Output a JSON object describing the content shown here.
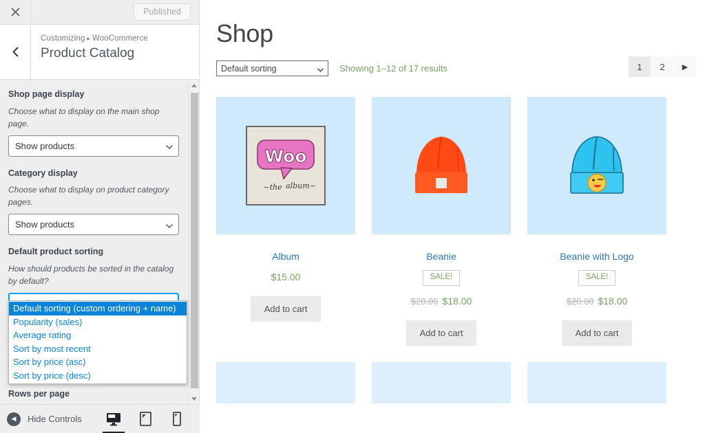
{
  "customizer": {
    "close_icon": "close-icon",
    "published_label": "Published",
    "back_icon": "chevron-left-icon",
    "breadcrumb_root": "Customizing",
    "breadcrumb_sep": "▸",
    "breadcrumb_section": "WooCommerce",
    "panel_title": "Product Catalog",
    "controls": [
      {
        "label": "Shop page display",
        "description": "Choose what to display on the main shop page.",
        "value": "Show products"
      },
      {
        "label": "Category display",
        "description": "Choose what to display on product category pages.",
        "value": "Show products"
      },
      {
        "label": "Default product sorting",
        "description": "How should products be sorted in the catalog by default?",
        "value": "Default sorting (custom ordering + r"
      }
    ],
    "sorting_options": [
      "Default sorting (custom ordering + name)",
      "Popularity (sales)",
      "Average rating",
      "Sort by most recent",
      "Sort by price (asc)",
      "Sort by price (desc)"
    ],
    "sorting_selected_index": 0,
    "rows_per_page_label": "Rows per page",
    "footer": {
      "hide_controls_label": "Hide Controls",
      "devices": [
        {
          "name": "desktop",
          "active": true
        },
        {
          "name": "tablet",
          "active": false
        },
        {
          "name": "mobile",
          "active": false
        }
      ]
    }
  },
  "preview": {
    "page_title": "Shop",
    "sorting_value": "Default sorting",
    "result_count": "Showing 1–12 of 17 results",
    "pagination": {
      "pages": [
        "1",
        "2"
      ],
      "current": "1",
      "next_label": "▶"
    },
    "products": [
      {
        "name": "Album",
        "image": "woo-album-artwork",
        "on_sale": false,
        "sale_label": "",
        "regular_price": "",
        "price": "$15.00",
        "add_to_cart": "Add to cart"
      },
      {
        "name": "Beanie",
        "image": "orange-beanie",
        "on_sale": true,
        "sale_label": "SALE!",
        "regular_price": "$20.00",
        "price": "$18.00",
        "add_to_cart": "Add to cart"
      },
      {
        "name": "Beanie with Logo",
        "image": "blue-beanie-with-logo",
        "on_sale": true,
        "sale_label": "SALE!",
        "regular_price": "$20.00",
        "price": "$18.00",
        "add_to_cart": "Add to cart"
      }
    ]
  },
  "colors": {
    "accent_green": "#77a464",
    "link_blue": "#2b7ab2",
    "focus_blue": "#00a0f2",
    "dropdown_highlight": "#0a84d8",
    "tile_blue": "#cfeafb",
    "button_gray": "#ebe9eb"
  }
}
